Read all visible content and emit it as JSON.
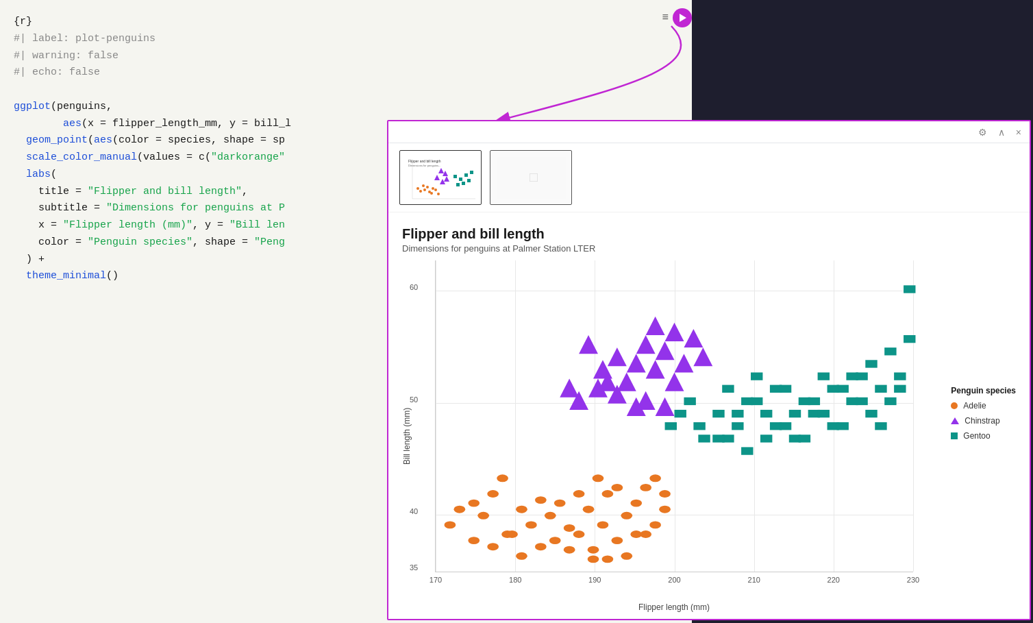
{
  "code": {
    "lines": [
      {
        "text": "{r}",
        "classes": [
          "c-black"
        ]
      },
      {
        "text": "#| label: plot-penguins",
        "classes": [
          "c-gray"
        ]
      },
      {
        "text": "#| warning: false",
        "classes": [
          "c-gray"
        ]
      },
      {
        "text": "#| echo: false",
        "classes": [
          "c-gray"
        ]
      },
      {
        "text": "",
        "classes": []
      },
      {
        "text": "ggplot(penguins,",
        "classes": [
          "c-black"
        ]
      },
      {
        "text": "      aes(x = flipper_length_mm, y = bill_l",
        "classes": [
          "c-black"
        ]
      },
      {
        "text": "  geom_point(aes(color = species, shape = sp",
        "classes": [
          "c-black"
        ]
      },
      {
        "text": "  scale_color_manual(values = c(\"darkorange\"",
        "classes": [
          "c-black"
        ]
      },
      {
        "text": "  labs(",
        "classes": [
          "c-black"
        ]
      },
      {
        "text": "    title = \"Flipper and bill length\",",
        "classes": [
          "c-black"
        ]
      },
      {
        "text": "    subtitle = \"Dimensions for penguins at P",
        "classes": [
          "c-black"
        ]
      },
      {
        "text": "    x = \"Flipper length (mm)\", y = \"Bill len",
        "classes": [
          "c-black"
        ]
      },
      {
        "text": "    color = \"Penguin species\", shape = \"Peng",
        "classes": [
          "c-black"
        ]
      },
      {
        "text": "  ) +",
        "classes": [
          "c-black"
        ]
      },
      {
        "text": "  theme_minimal()",
        "classes": [
          "c-black"
        ]
      }
    ],
    "highlighted": {
      "ggplot": "#1d4ed8",
      "aes": "#1d4ed8",
      "geom_point": "#1d4ed8",
      "scale_color_manual": "#1d4ed8",
      "labs": "#1d4ed8",
      "theme_minimal": "#1d4ed8",
      "string_color": "#16a34a",
      "comment_color": "#888888"
    }
  },
  "chart": {
    "title": "Flipper and bill length",
    "subtitle": "Dimensions for penguins at Palmer Station LTER",
    "x_label": "Flipper length (mm)",
    "y_label": "Bill length (mm)",
    "legend_title": "Penguin species",
    "legend_items": [
      {
        "label": "Adelie",
        "shape": "dot",
        "color": "#e87722"
      },
      {
        "label": "Chinstrap",
        "shape": "triangle",
        "color": "#9333ea"
      },
      {
        "label": "Gentoo",
        "shape": "square",
        "color": "#0d9488"
      }
    ],
    "y_ticks": [
      40,
      50,
      60
    ],
    "x_ticks": [
      170,
      180,
      190,
      200,
      210,
      220,
      230
    ]
  },
  "toolbar": {
    "run_label": "▶",
    "lines_icon": "≡",
    "close_label": "×",
    "expand_label": "⌃",
    "settings_label": "⚙"
  }
}
